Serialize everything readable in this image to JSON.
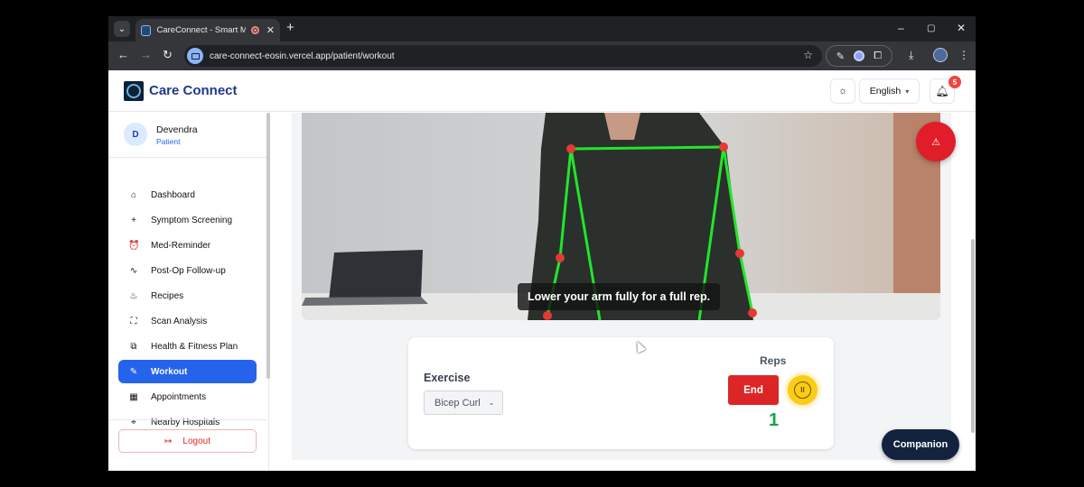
{
  "browser": {
    "tab_title": "CareConnect - Smart Medic",
    "new_tab_symbol": "+",
    "url": "care-connect-eosin.vercel.app/patient/workout",
    "window_controls": [
      "–",
      "▢",
      "✕"
    ]
  },
  "app": {
    "brand": "Care Connect",
    "language": "English",
    "notification_count": "5",
    "icons": [
      "sun-icon",
      "bell-icon",
      "chevron-down-icon",
      "alert-triangle-icon",
      "logo-icon"
    ]
  },
  "user": {
    "initial": "D",
    "name": "Devendra",
    "role": "Patient"
  },
  "sidebar": {
    "items": [
      {
        "label": "Dashboard",
        "icon": "⌂"
      },
      {
        "label": "Symptom Screening",
        "icon": "+"
      },
      {
        "label": "Med-Reminder",
        "icon": "⏰"
      },
      {
        "label": "Post-Op Follow-up",
        "icon": "∿"
      },
      {
        "label": "Recipes",
        "icon": "♨"
      },
      {
        "label": "Scan Analysis",
        "icon": "⛶"
      },
      {
        "label": "Health & Fitness Plan",
        "icon": "⧉"
      },
      {
        "label": "Workout",
        "icon": "✎",
        "active": true
      },
      {
        "label": "Appointments",
        "icon": "▦"
      },
      {
        "label": "Nearby Hospitals",
        "icon": "⌖"
      }
    ],
    "logout_label": "Logout",
    "logout_icon": "↦"
  },
  "workout": {
    "feedback": "Lower your arm fully for a full rep.",
    "exercise_label": "Exercise",
    "exercise_selected": "Bicep Curl",
    "reps_label": "Reps",
    "end_label": "End",
    "rep_count": "1",
    "pause_symbol": "II"
  },
  "companion_label": "Companion",
  "colors": {
    "primary": "#2563eb",
    "danger": "#dc2626",
    "success": "#16a34a",
    "pose_line": "#22e52b",
    "pose_joint": "#e53935",
    "pause_yellow": "#facc15",
    "companion_bg": "#13233f"
  }
}
